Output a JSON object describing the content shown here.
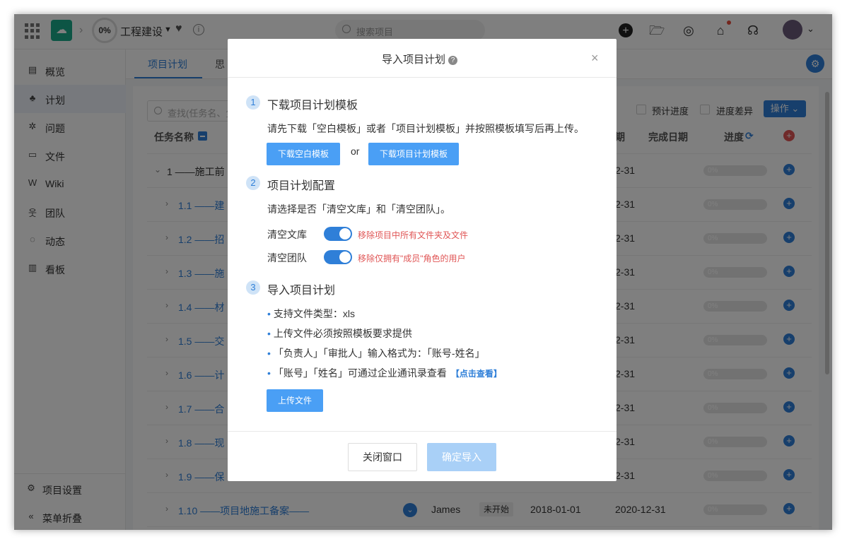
{
  "topbar": {
    "progress": "0%",
    "project_name": "工程建设",
    "search_placeholder": "搜索项目",
    "icons": [
      "plus-icon",
      "folder-icon",
      "help-ring-icon",
      "notification-icon",
      "headset-icon"
    ]
  },
  "sidebar": {
    "items": [
      {
        "label": "概览",
        "icon": "overview-icon"
      },
      {
        "label": "计划",
        "icon": "plan-icon"
      },
      {
        "label": "问题",
        "icon": "bug-icon"
      },
      {
        "label": "文件",
        "icon": "folder-icon"
      },
      {
        "label": "Wiki",
        "icon": "wiki-icon"
      },
      {
        "label": "团队",
        "icon": "team-icon"
      },
      {
        "label": "动态",
        "icon": "activity-icon"
      },
      {
        "label": "看板",
        "icon": "chart-icon"
      }
    ],
    "settings_label": "项目设置",
    "collapse_label": "菜单折叠"
  },
  "main": {
    "tabs": [
      {
        "label": "项目计划"
      },
      {
        "label": "思"
      }
    ],
    "filter_placeholder": "查找(任务名、负",
    "chk_expected": "预计进度",
    "chk_diff": "进度差异",
    "ops_label": "操作",
    "col_task": "任务名称",
    "col_end_partial": "期",
    "col_done": "完成日期",
    "col_progress": "进度",
    "rows": [
      {
        "num": "1 ——施工前",
        "date": "2-31"
      },
      {
        "num": "1.1 ——建",
        "date": "2-31"
      },
      {
        "num": "1.2 ——招",
        "date": "2-31"
      },
      {
        "num": "1.3 ——施",
        "date": "2-31"
      },
      {
        "num": "1.4 ——材",
        "date": "2-31"
      },
      {
        "num": "1.5 ——交",
        "date": "2-31"
      },
      {
        "num": "1.6 ——计",
        "date": "2-31"
      },
      {
        "num": "1.7 ——合",
        "date": "2-31"
      },
      {
        "num": "1.8 ——现",
        "date": "2-31"
      },
      {
        "num": "1.9 ——保",
        "date": "2-31"
      },
      {
        "num": "1.10 ——项目地施工备案——",
        "owner": "James",
        "status": "未开始",
        "start": "2018-01-01",
        "date": "2020-12-31"
      }
    ],
    "progress_text": "0%"
  },
  "modal": {
    "title": "导入项目计划",
    "step1": {
      "num": "1",
      "title": "下载项目计划模板",
      "desc": "请先下载「空白模板」或者「项目计划模板」并按照模板填写后再上传。",
      "btn_blank": "下载空白模板",
      "or": "or",
      "btn_template": "下载项目计划模板"
    },
    "step2": {
      "num": "2",
      "title": "项目计划配置",
      "desc": "请选择是否「清空文库」和「清空团队」。",
      "clear_lib_label": "清空文库",
      "clear_lib_hint": "移除项目中所有文件夹及文件",
      "clear_team_label": "清空团队",
      "clear_team_hint": "移除仅拥有\"成员\"角色的用户"
    },
    "step3": {
      "num": "3",
      "title": "导入项目计划",
      "bullets": [
        "支持文件类型：xls",
        "上传文件必须按照模板要求提供",
        "「负责人」「审批人」输入格式为：「账号-姓名」",
        "「账号」「姓名」可通过企业通讯录查看"
      ],
      "view_link": "【点击查看】",
      "upload_btn": "上传文件"
    },
    "footer": {
      "close_btn": "关闭窗口",
      "confirm_btn": "确定导入"
    }
  }
}
